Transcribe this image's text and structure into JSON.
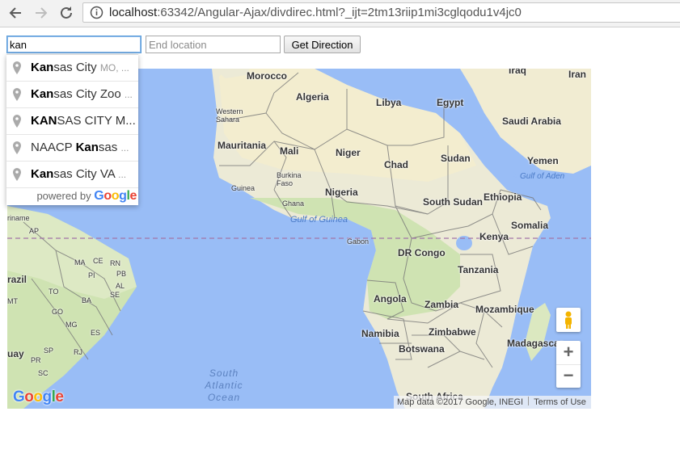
{
  "browser": {
    "url_host": "localhost",
    "url_rest": ":63342/Angular-Ajax/divdirec.html?_ijt=2tm13riip1mi3cglqodu1v4jc0"
  },
  "form": {
    "start_value": "kan",
    "end_placeholder": "End location",
    "button_label": "Get Direction"
  },
  "autocomplete": {
    "items": [
      {
        "match": "Kan",
        "rest": "sas City",
        "secondary": "MO, ..."
      },
      {
        "match": "Kan",
        "rest": "sas City Zoo",
        "secondary": "..."
      },
      {
        "match": "KAN",
        "rest": "SAS CITY M...",
        "secondary": ""
      },
      {
        "pre": "NAACP ",
        "match": "Kan",
        "rest": "sas",
        "secondary": "..."
      },
      {
        "match": "Kan",
        "rest": "sas City VA",
        "secondary": "..."
      }
    ],
    "footer_text": "powered by",
    "footer_brand": "Google"
  },
  "map": {
    "labels": {
      "morocco": "Morocco",
      "algeria": "Algeria",
      "libya": "Libya",
      "egypt": "Egypt",
      "iraq": "Iraq",
      "iran": "Iran",
      "saudi": "Saudi Arabia",
      "yemen": "Yemen",
      "western_sahara": "Western Sahara",
      "mauritania": "Mauritania",
      "mali": "Mali",
      "niger": "Niger",
      "chad": "Chad",
      "sudan": "Sudan",
      "burkina": "Burkina Faso",
      "guinea": "Guinea",
      "ghana": "Ghana",
      "nigeria": "Nigeria",
      "south_sudan": "South Sudan",
      "ethiopia": "Ethiopia",
      "somalia": "Somalia",
      "gabon": "Gabon",
      "drc": "DR Congo",
      "kenya": "Kenya",
      "tanzania": "Tanzania",
      "angola": "Angola",
      "zambia": "Zambia",
      "mozambique": "Mozambique",
      "namibia": "Namibia",
      "zimbabwe": "Zimbabwe",
      "botswana": "Botswana",
      "madagascar": "Madagascar",
      "south_africa": "South Africa",
      "brazil": "razil",
      "suriname": "riname",
      "br_ap": "AP",
      "br_ma": "MA",
      "br_ce": "CE",
      "br_rn": "RN",
      "br_pb": "PB",
      "br_pi": "PI",
      "br_al": "AL",
      "br_to": "TO",
      "br_se": "SE",
      "br_mt": "MT",
      "br_ba": "BA",
      "br_go": "GO",
      "br_mg": "MG",
      "br_es": "ES",
      "br_sp": "SP",
      "br_rj": "RJ",
      "br_pr": "PR",
      "br_sc": "SC",
      "uruguay": "uay",
      "gulf_guinea": "Gulf of Guinea",
      "gulf_aden": "Gulf of Aden",
      "ocean_1": "South",
      "ocean_2": "Atlantic",
      "ocean_3": "Ocean"
    },
    "logo": "Google",
    "attribution": "Map data ©2017 Google, INEGI",
    "terms": "Terms of Use",
    "zoom_in": "+",
    "zoom_out": "−"
  },
  "colors": {
    "water": "#99bdf6",
    "land": "#ecead6",
    "desert": "#f3edcf",
    "vegetation": "#cfe3b2"
  }
}
